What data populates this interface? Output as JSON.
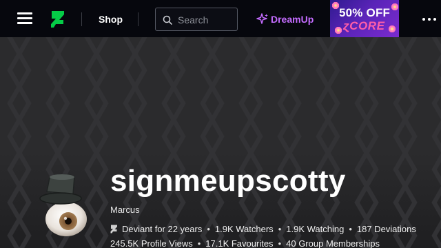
{
  "nav": {
    "menu_icon": "hamburger-menu-icon",
    "logo_icon": "deviantart-logo-icon",
    "shop_label": "Shop",
    "search": {
      "placeholder": "Search",
      "value": "",
      "icon": "search-icon"
    },
    "dreamup_label": "DreamUp",
    "dreamup_icon": "sparkle-icon",
    "promo": {
      "line1": "50% OFF",
      "line2": "ɀCORE"
    },
    "more_icon": "more-dots-icon"
  },
  "profile": {
    "username": "signmeupscotty",
    "real_name": "Marcus",
    "deviant_for": "Deviant for 22 years",
    "watchers": "1.9K Watchers",
    "watching": "1.9K Watching",
    "deviations": "187 Deviations",
    "profile_views": "245.5K Profile Views",
    "favourites": "17.1K Favourites",
    "group_memberships": "40 Group Memberships"
  },
  "colors": {
    "topbar_bg": "#06070d",
    "brand_green": "#05cc47",
    "dreamup_purple": "#c46cff",
    "banner_bg": "#2b2b2d"
  }
}
